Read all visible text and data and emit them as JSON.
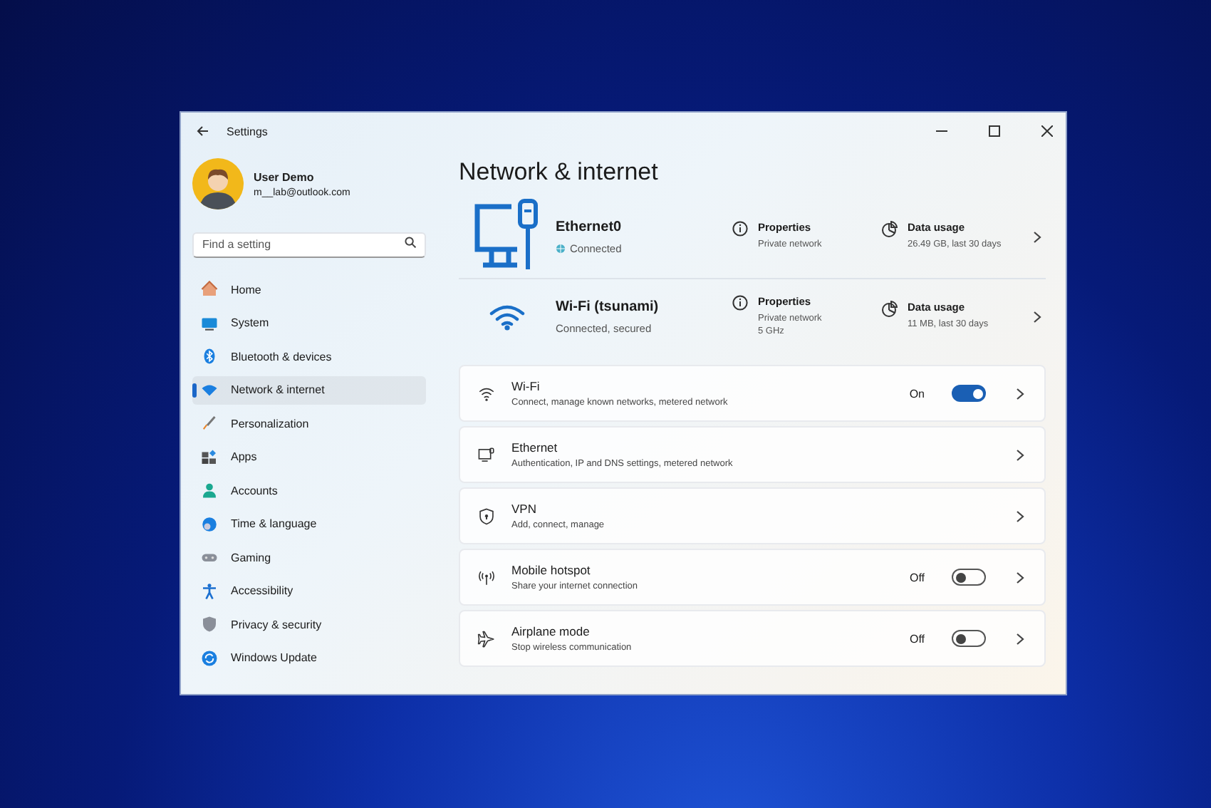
{
  "window": {
    "title": "Settings"
  },
  "user": {
    "name": "User Demo",
    "email": "m__lab@outlook.com"
  },
  "search": {
    "placeholder": "Find a setting"
  },
  "nav": [
    {
      "label": "Home",
      "selected": false
    },
    {
      "label": "System",
      "selected": false
    },
    {
      "label": "Bluetooth & devices",
      "selected": false
    },
    {
      "label": "Network & internet",
      "selected": true
    },
    {
      "label": "Personalization",
      "selected": false
    },
    {
      "label": "Apps",
      "selected": false
    },
    {
      "label": "Accounts",
      "selected": false
    },
    {
      "label": "Time & language",
      "selected": false
    },
    {
      "label": "Gaming",
      "selected": false
    },
    {
      "label": "Accessibility",
      "selected": false
    },
    {
      "label": "Privacy & security",
      "selected": false
    },
    {
      "label": "Windows Update",
      "selected": false
    }
  ],
  "page_title": "Network & internet",
  "connections": [
    {
      "kind": "ethernet",
      "name": "Ethernet0",
      "status": "Connected",
      "properties_label": "Properties",
      "properties": [
        "Private network"
      ],
      "usage_label": "Data usage",
      "usage": "26.49 GB, last 30 days"
    },
    {
      "kind": "wifi",
      "name": "Wi-Fi (tsunami)",
      "status": "Connected, secured",
      "properties_label": "Properties",
      "properties": [
        "Private network",
        "5 GHz"
      ],
      "usage_label": "Data usage",
      "usage": "11 MB, last 30 days"
    }
  ],
  "settings": [
    {
      "title": "Wi-Fi",
      "subtitle": "Connect, manage known networks, metered network",
      "kind": "toggle",
      "toggle_label": "On",
      "on": true
    },
    {
      "title": "Ethernet",
      "subtitle": "Authentication, IP and DNS settings, metered network",
      "kind": "link"
    },
    {
      "title": "VPN",
      "subtitle": "Add, connect, manage",
      "kind": "link"
    },
    {
      "title": "Mobile hotspot",
      "subtitle": "Share your internet connection",
      "kind": "toggle",
      "toggle_label": "Off",
      "on": false
    },
    {
      "title": "Airplane mode",
      "subtitle": "Stop wireless communication",
      "kind": "toggle",
      "toggle_label": "Off",
      "on": false
    }
  ]
}
